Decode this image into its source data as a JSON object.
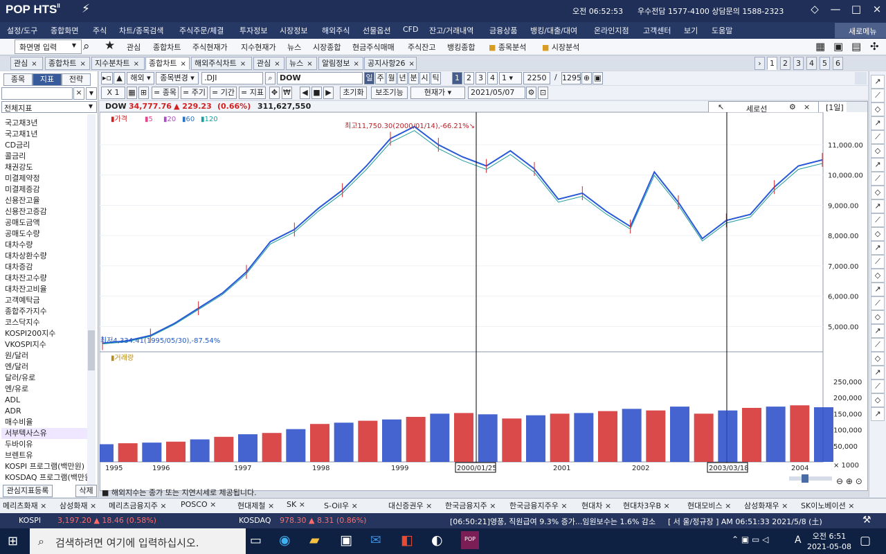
{
  "window": {
    "logo": "POP HTS",
    "logo_superscript": "II",
    "clock": "오전 06:52:53",
    "support": "우수전담 1577-4100 상담문의 1588-2323"
  },
  "menu": [
    "설정/도구",
    "종합화면",
    "주식",
    "차트/종목검색",
    "주식주문/체결",
    "투자정보",
    "시장정보",
    "해외주식",
    "선물옵션",
    "CFD",
    "잔고/거래내역",
    "금융상품",
    "뱅킹/대출/대여",
    "온라인지점",
    "고객센터",
    "보기",
    "도움말"
  ],
  "new_menu": "새로메뉴",
  "toolbar": {
    "screen_input": "화면명 입력",
    "items": [
      "관심",
      "종합차트",
      "주식현재가",
      "지수현재가",
      "뉴스",
      "시장종합",
      "현금주식매매",
      "주식잔고",
      "뱅킹종합",
      "종목분석",
      "시장분석"
    ]
  },
  "tabs": [
    "관심",
    "종합차트",
    "지수분차트",
    "종합차트",
    "해외주식차트",
    "관심",
    "뉴스",
    "알림정보",
    "공지사항26"
  ],
  "tab_pages": [
    "1",
    "2",
    "3",
    "4",
    "5",
    "6"
  ],
  "sidebar": {
    "tabs": [
      "종목",
      "지표",
      "전략"
    ],
    "filter": "전체지표",
    "items": [
      "국고채3년",
      "국고채1년",
      "CD금리",
      "콜금리",
      "채권강도",
      "미결제약정",
      "미결제증감",
      "신용잔고율",
      "신용잔고증감",
      "공매도금액",
      "공매도수량",
      "대차수량",
      "대차상환수량",
      "대차증감",
      "대차잔고수량",
      "대차잔고비율",
      "고객예탁금",
      "종합주가지수",
      "코스닥지수",
      "KOSPI200지수",
      "VKOSPI지수",
      "원/달러",
      "엔/달러",
      "달러/유로",
      "엔/유로",
      "ADL",
      "ADR",
      "매수비율",
      "서부텍사스유",
      "두바이유",
      "브렌트유",
      "KOSPI 프로그램(백만원)",
      "KOSDAQ 프로그램(백만원)"
    ],
    "register_button": "관심지표등록",
    "delete_button": "삭제"
  },
  "controls": {
    "market": "해외",
    "change": "종목변경",
    "symbol_code": ".DJI",
    "symbol_name": "DOW",
    "periods": [
      "일",
      "주",
      "월",
      "년",
      "분",
      "시",
      "틱"
    ],
    "numbers": [
      "1",
      "2",
      "3",
      "4",
      "1"
    ],
    "count1": "2250",
    "count2": "1295",
    "row2": [
      "X 1",
      "종목",
      "주기",
      "기간",
      "지표",
      "초기화",
      "보조기능",
      "현재가"
    ],
    "date": "2021/05/07"
  },
  "chart_info": {
    "symbol": "DOW",
    "price": "34,777.76",
    "change": "▲ 229.23",
    "percent": "(0.66%)",
    "volume": "311,627,550",
    "panel": "세로선",
    "period_badge": "[1일]"
  },
  "chart_data": {
    "type": "line",
    "legend": [
      "가격",
      "5",
      "20",
      "60",
      "120"
    ],
    "high_note": "최고11,750.30(2000/01/14),-66.21%",
    "low_note": "최저4,334.41(1995/05/30),-87.54%",
    "x_ticks": [
      "1995",
      "1996",
      "1997",
      "1998",
      "1999",
      "2000/01/25",
      "2001",
      "2002",
      "2003/03/18",
      "2004"
    ],
    "y_ticks": [
      "11,000.00",
      "10,000.00",
      "9,000.00",
      "8,000.00",
      "7,000.00",
      "6,000.00",
      "5,000.00"
    ],
    "price_values": [
      4450,
      4520,
      4700,
      5100,
      5600,
      6100,
      6800,
      7800,
      8200,
      8900,
      9500,
      10300,
      11200,
      11600,
      11000,
      10600,
      10300,
      10800,
      10200,
      9200,
      9400,
      8800,
      8300,
      10100,
      9100,
      7900,
      8500,
      8700,
      9600,
      10300,
      10500
    ],
    "volume_label": "거래량",
    "volume_ticks": [
      "250,000",
      "200,000",
      "150,000",
      "100,000",
      "50,000",
      "× 1000"
    ],
    "volume_values": [
      55,
      58,
      60,
      63,
      70,
      78,
      86,
      90,
      102,
      118,
      122,
      128,
      132,
      140,
      150,
      152,
      148,
      135,
      145,
      150,
      152,
      158,
      165,
      160,
      172,
      150,
      160,
      168,
      172,
      176,
      170
    ]
  },
  "status_text": "■ 해외지수는 종가 또는 지연시세로 제공됩니다.",
  "bottom_tabs": [
    "메리츠화재",
    "삼성화재",
    "메리츠금융지주",
    "POSCO",
    "현대제철",
    "SK",
    "S-Oil우",
    "대신증권우",
    "한국금융지주",
    "한국금융지주우",
    "현대차",
    "현대차3우B",
    "현대모비스",
    "삼성화재우",
    "SK이노베이션"
  ],
  "ticker": {
    "kospi_label": "KOSPI",
    "kospi": "3,197.20 ▲ 18.46 (0.58%)",
    "kosdaq_label": "KOSDAQ",
    "kosdaq": "978.30 ▲ 8.31 (0.86%)",
    "news": "[06:50:21]영풍, 직원급여 9.3% 증가...임원보수는 1.6% 감소",
    "server_time": "[ 서 울/정규장 ] AM 06:51:33 2021/5/8 (土)"
  },
  "taskbar": {
    "search_placeholder": "검색하려면 여기에 입력하십시오.",
    "time": "오전 6:51",
    "date": "2021-05-08",
    "lang": "A"
  }
}
